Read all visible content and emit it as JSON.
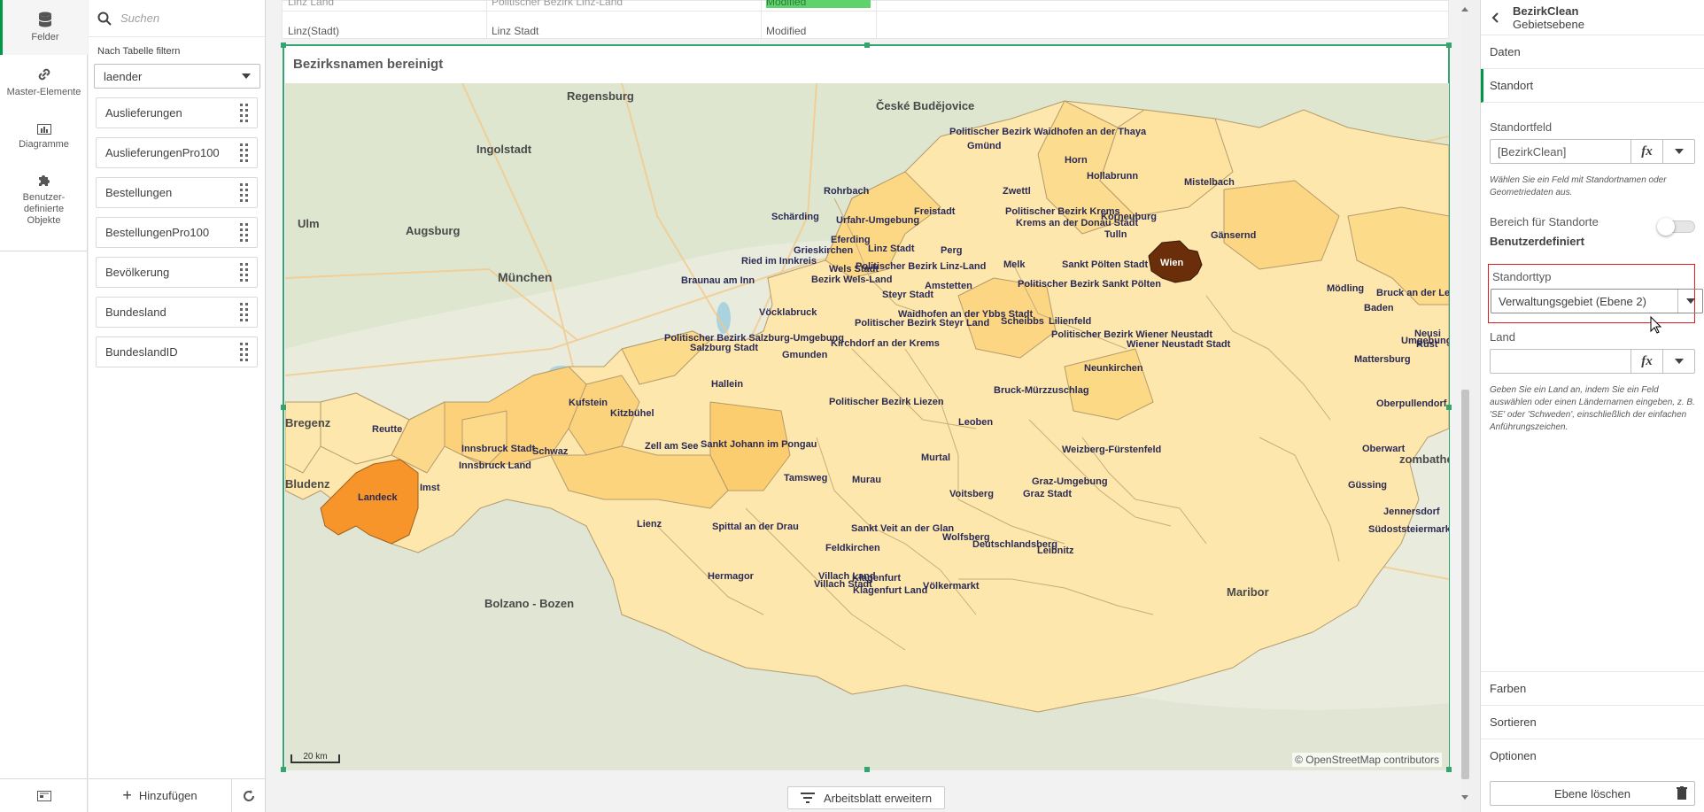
{
  "rail": {
    "items": [
      {
        "label": "Felder",
        "icon": "database-icon"
      },
      {
        "label": "Master-Elemente",
        "icon": "link-icon"
      },
      {
        "label": "Diagramme",
        "icon": "bar-chart-icon"
      },
      {
        "label": "Benutzer-\ndefinierte\nObjekte",
        "icon": "puzzle-icon"
      }
    ]
  },
  "fields_panel": {
    "search_placeholder": "Suchen",
    "filter_label": "Nach Tabelle filtern",
    "filter_value": "laender",
    "fields": [
      "Auslieferungen",
      "AuslieferungenPro100",
      "Bestellungen",
      "BestellungenPro100",
      "Bevölkerung",
      "Bundesland",
      "BundeslandID"
    ],
    "add_label": "Hinzufügen"
  },
  "table_strip": {
    "row1": [
      "Linz Land",
      "Politischer Bezirk Linz-Land",
      "Modified"
    ],
    "row2": [
      "Linz(Stadt)",
      "Linz Stadt",
      "Modified"
    ]
  },
  "map": {
    "title": "Bezirksnamen bereinigt",
    "scale": "20 km",
    "attribution": "© OpenStreetMap contributors",
    "colors": {
      "land": "#e6ead9",
      "district_light": "#fde9b0",
      "district_mid": "#fcd37a",
      "district_dark": "#f7952a",
      "district_max": "#6b2e0a",
      "border": "#8a7a60"
    },
    "cities": [
      {
        "name": "Regensburg"
      },
      {
        "name": "České Budějovice"
      },
      {
        "name": "Ingolstadt"
      },
      {
        "name": "Augsburg"
      },
      {
        "name": "Ulm"
      },
      {
        "name": "München"
      },
      {
        "name": "Bregenz"
      },
      {
        "name": "Bludenz"
      },
      {
        "name": "Bolzano - Bozen"
      },
      {
        "name": "Maribor"
      },
      {
        "name": "zombathely"
      }
    ],
    "districts": [
      "Politischer Bezirk Waidhofen an der Thaya",
      "Gmünd",
      "Horn",
      "Hollabrunn",
      "Mistelbach",
      "Rohrbach",
      "Zwettl",
      "Freistadt",
      "Politischer Bezirk Krems",
      "Krems an der Donau Stadt",
      "Korneuburg",
      "Tulln",
      "Gänsernd",
      "Schärding",
      "Urfahr-Umgebung",
      "Grieskirchen",
      "Eferding",
      "Linz Stadt",
      "Perg",
      "Melk",
      "Sankt Pölten Stadt",
      "Wien",
      "Ried im Innkreis",
      "Politischer Bezirk Linz-Land",
      "Wels Stadt",
      "Bezirk Wels-Land",
      "Politischer Bezirk Sankt Pölten",
      "Braunau am Inn",
      "Amstetten",
      "Steyr Stadt",
      "Mödling",
      "Bruck an der Le",
      "Vöcklabruck",
      "Waidhofen an der Ybbs Stadt",
      "Baden",
      "Politischer Bezirk Steyr Land",
      "Scheibbs",
      "Lilienfeld",
      "Politischer Bezirk Salzburg-Umgebung",
      "Salzburg Stadt",
      "Politischer Bezirk Wiener Neustadt",
      "Neusi",
      "Wiener Neustadt Stadt",
      "Umgebung",
      "Rust",
      "Kirchdorf an der Krems",
      "Gmunden",
      "Mattersburg",
      "Neunkirchen",
      "Hallein",
      "Kufstein",
      "Politischer Bezirk Liezen",
      "Bruck-Mürzzuschlag",
      "Oberpullendorf",
      "Kitzbühel",
      "Reutte",
      "Innsbruck Stadt",
      "Zell am See",
      "Sankt Johann im Pongau",
      "Leoben",
      "Schwaz",
      "Innsbruck Land",
      "Weizberg-Fürstenfeld",
      "Oberwart",
      "Murtal",
      "Imst",
      "Tamsweg",
      "Murau",
      "Landeck",
      "Graz-Umgebung",
      "Graz Stadt",
      "Voitsberg",
      "Güssing",
      "Lienz",
      "Spittal an der Drau",
      "Jennersdorf",
      "Sankt Veit an der Glan",
      "Südoststeiermark",
      "Wolfsberg",
      "Deutschlandsberg",
      "Feldkirchen",
      "Leibnitz",
      "Hermagor",
      "Villach Land",
      "Klagenfurt",
      "Villach Stadt",
      "Völkermarkt",
      "Klagenfurt Land"
    ]
  },
  "expand_label": "Arbeitsblatt erweitern",
  "props": {
    "title": "BezirkClean",
    "subtitle": "Gebietsebene",
    "sections_top": [
      "Daten",
      "Standort"
    ],
    "standortfeld_label": "Standortfeld",
    "standortfeld_value": "[BezirkClean]",
    "standortfeld_help": "Wählen Sie ein Feld mit Standortnamen oder Geometriedaten aus.",
    "range_label": "Bereich für Standorte",
    "range_value": "Benutzerdefiniert",
    "type_label": "Standorttyp",
    "type_value": "Verwaltungsgebiet (Ebene 2)",
    "land_label": "Land",
    "land_value": "",
    "land_help": "Geben Sie ein Land an, indem Sie ein Feld auswählen oder einen Ländernamen eingeben, z. B. 'SE' oder 'Schweden', einschließlich der einfachen Anführungszeichen.",
    "fx": "fx",
    "sections_bottom": [
      "Farben",
      "Sortieren",
      "Optionen"
    ],
    "delete_label": "Ebene löschen"
  }
}
